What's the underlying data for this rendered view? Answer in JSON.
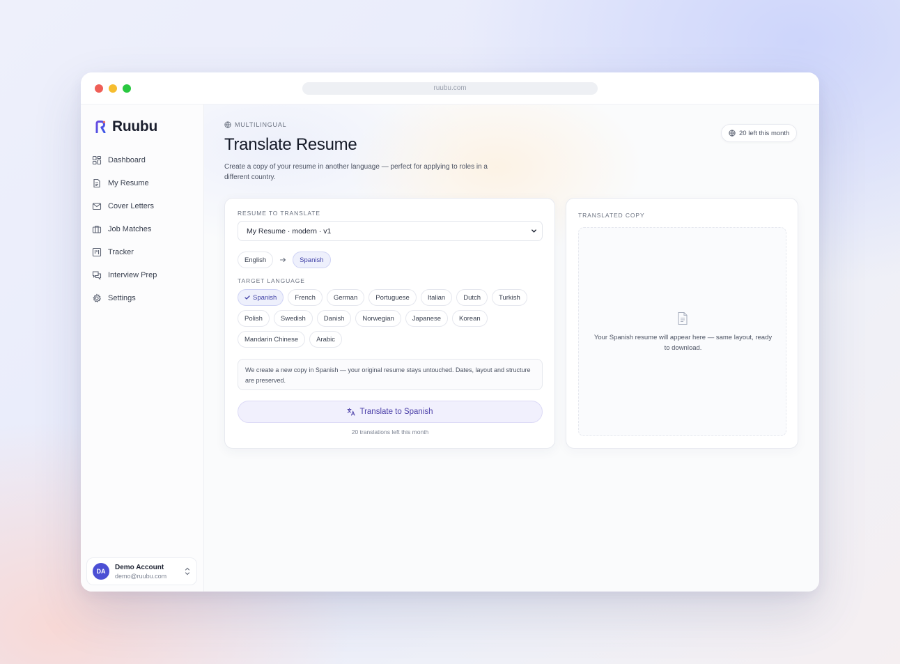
{
  "browser": {
    "url": "ruubu.com"
  },
  "brand": {
    "name": "Ruubu",
    "accent": "#4b4fd4"
  },
  "sidebar": {
    "items": [
      {
        "label": "Dashboard",
        "icon": "grid-icon"
      },
      {
        "label": "My Resume",
        "icon": "document-icon"
      },
      {
        "label": "Cover Letters",
        "icon": "mail-icon"
      },
      {
        "label": "Job Matches",
        "icon": "briefcase-icon"
      },
      {
        "label": "Tracker",
        "icon": "kanban-icon"
      },
      {
        "label": "Interview Prep",
        "icon": "chat-icon"
      },
      {
        "label": "Settings",
        "icon": "gear-icon"
      }
    ],
    "account": {
      "initials": "DA",
      "name": "Demo Account",
      "email": "demo@ruubu.com"
    }
  },
  "header": {
    "eyebrow": "MULTILINGUAL",
    "title": "Translate Resume",
    "description": "Create a copy of your resume in another language — perfect for applying to roles in a different country.",
    "quota": "20 left this month"
  },
  "form": {
    "resume_label": "RESUME TO TRANSLATE",
    "resume_selected": "My Resume · modern · v1",
    "source_language": "English",
    "target_selected": "Spanish",
    "target_label": "TARGET LANGUAGE",
    "languages": [
      [
        "Spanish",
        "French",
        "German",
        "Portuguese",
        "Italian",
        "Dutch",
        "Turkish"
      ],
      [
        "Polish",
        "Swedish",
        "Danish",
        "Norwegian",
        "Japanese",
        "Korean"
      ],
      [
        "Mandarin Chinese",
        "Arabic"
      ]
    ],
    "note": "We create a new copy in Spanish — your original resume stays untouched. Dates, layout and structure are preserved.",
    "button_label": "Translate to Spanish",
    "button_sub": "20 translations left this month"
  },
  "output": {
    "label": "TRANSLATED COPY",
    "placeholder": "Your Spanish resume will appear here — same layout, ready to download."
  }
}
